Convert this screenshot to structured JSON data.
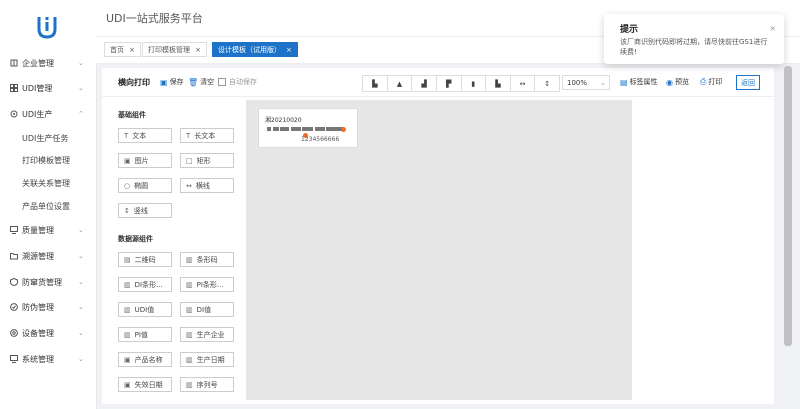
{
  "app": {
    "title": "UDI一站式服务平台"
  },
  "sidebar": {
    "items": [
      {
        "label": "企业管理",
        "icon": "building-icon",
        "chevron": "⌄"
      },
      {
        "label": "UDI管理",
        "icon": "grid-icon",
        "chevron": "⌄"
      },
      {
        "label": "UDI生产",
        "icon": "cog-icon",
        "chevron": "⌃"
      },
      {
        "label": "质量管理",
        "icon": "monitor-icon",
        "chevron": "⌄"
      },
      {
        "label": "溯源管理",
        "icon": "folder-icon",
        "chevron": "⌄"
      },
      {
        "label": "防窜货管理",
        "icon": "shield-icon",
        "chevron": "⌄"
      },
      {
        "label": "防伪管理",
        "icon": "shield-check-icon",
        "chevron": "⌄"
      },
      {
        "label": "设备管理",
        "icon": "settings-icon",
        "chevron": "⌄"
      },
      {
        "label": "系统管理",
        "icon": "monitor-icon",
        "chevron": "⌄"
      }
    ],
    "subitems": [
      "UDI生产任务",
      "打印模板管理",
      "关联关系管理",
      "产品单位设置"
    ]
  },
  "tabs": [
    {
      "label": "首页",
      "close": "×"
    },
    {
      "label": "打印模板管理",
      "close": "×"
    },
    {
      "label": "设计模板（试用版）",
      "close": "×"
    }
  ],
  "toolbar": {
    "title": "横向打印",
    "save": "保存",
    "clear": "清空",
    "autosave": "自动保存",
    "zoom": "100%",
    "label_props": "标签属性",
    "preview": "预览",
    "print": "打印",
    "back": "返回",
    "align_icons": [
      "align-left-icon",
      "align-center-icon",
      "align-right-icon",
      "align-top-icon",
      "align-middle-icon",
      "align-bottom-icon",
      "distribute-horizontal-icon",
      "distribute-vertical-icon"
    ]
  },
  "basic": {
    "title": "基础组件",
    "items": [
      {
        "label": "文本",
        "icon": "T"
      },
      {
        "label": "长文本",
        "icon": "T"
      },
      {
        "label": "图片",
        "icon": "▣"
      },
      {
        "label": "矩形",
        "icon": "□"
      },
      {
        "label": "椭圆",
        "icon": "○"
      },
      {
        "label": "横线",
        "icon": "↔"
      },
      {
        "label": "竖线",
        "icon": "↕"
      }
    ]
  },
  "datasource": {
    "title": "数据源组件",
    "items": [
      {
        "label": "二维码",
        "icon": "▤"
      },
      {
        "label": "条形码",
        "icon": "▥"
      },
      {
        "label": "DI条形...",
        "icon": "▥"
      },
      {
        "label": "PI条形...",
        "icon": "▥"
      },
      {
        "label": "UDI值",
        "icon": "▥"
      },
      {
        "label": "DI值",
        "icon": "▥"
      },
      {
        "label": "PI值",
        "icon": "▥"
      },
      {
        "label": "生产企业",
        "icon": "▥"
      },
      {
        "label": "产品名称",
        "icon": "▣"
      },
      {
        "label": "生产日期",
        "icon": "▥"
      },
      {
        "label": "失效日期",
        "icon": "▣"
      },
      {
        "label": "序列号",
        "icon": "▥"
      }
    ]
  },
  "canvas": {
    "label_text": "湘20210020",
    "barcode_text": "1234566666"
  },
  "notification": {
    "title": "提示",
    "body": "该厂商识别代码即将过期，请尽快前往GS1进行续费!",
    "close": "×"
  }
}
